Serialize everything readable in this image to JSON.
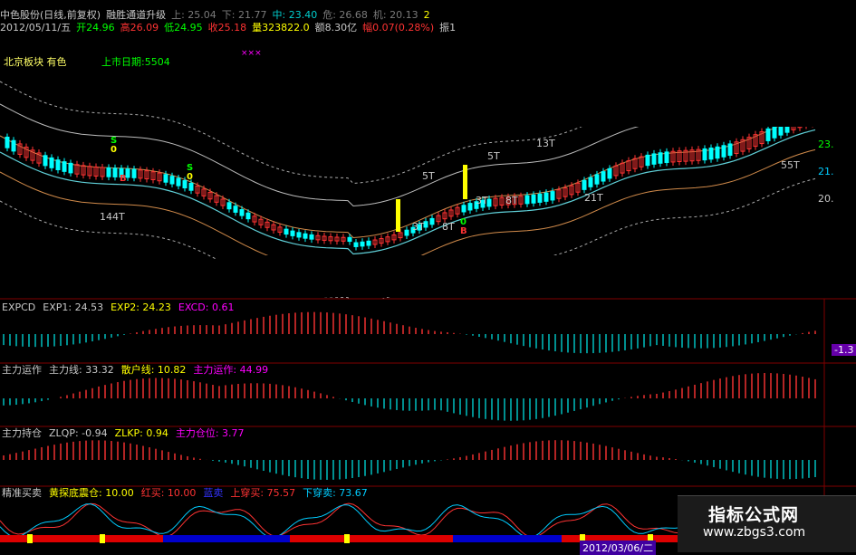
{
  "header": {
    "line1": [
      {
        "text": "中色股份(日线,前复权)",
        "color": "#c8c8c8"
      },
      {
        "text": "融胜通道升级",
        "color": "#c8c8c8"
      },
      {
        "text": "上: 25.04",
        "color": "#7a7a7a"
      },
      {
        "text": "下: 21.77",
        "color": "#7a7a7a"
      },
      {
        "text": "中: 23.40",
        "color": "#00d0d0"
      },
      {
        "text": "危: 26.68",
        "color": "#7a7a7a"
      },
      {
        "text": "机: 20.13",
        "color": "#7a7a7a"
      },
      {
        "text": "2",
        "color": "#ffff00"
      }
    ],
    "line2": [
      {
        "text": "2012/05/11/五",
        "color": "#c8c8c8"
      },
      {
        "text": "开24.96",
        "color": "#00ff00"
      },
      {
        "text": "高26.09",
        "color": "#ff3333"
      },
      {
        "text": "低24.95",
        "color": "#00ff00"
      },
      {
        "text": "收25.18",
        "color": "#ff3333"
      },
      {
        "text": "量323822.0",
        "color": "#ffff00"
      },
      {
        "text": "额8.30亿",
        "color": "#c8c8c8"
      },
      {
        "text": "幅0.07(0.28%)",
        "color": "#ff3333"
      },
      {
        "text": "振1",
        "color": "#c8c8c8"
      }
    ],
    "board_label": "北京板块 有色",
    "listing_label": "上市日期:5504",
    "xxx": "×××"
  },
  "main_labels": [
    {
      "text": "S",
      "color": "#00ff00"
    },
    {
      "text": "0",
      "color": "#ffff00"
    },
    {
      "text": "B",
      "color": "#ff3333"
    },
    {
      "text": "S",
      "color": "#00ff00"
    },
    {
      "text": "0",
      "color": "#ffff00"
    },
    {
      "text": "144T",
      "color": "#c8c8c8"
    },
    {
      "text": "3T",
      "color": "#c8c8c8"
    },
    {
      "text": "8T",
      "color": "#c8c8c8"
    },
    {
      "text": "5T",
      "color": "#c8c8c8"
    },
    {
      "text": "0",
      "color": "#00ff00"
    },
    {
      "text": "B",
      "color": "#ff3333"
    },
    {
      "text": "3T",
      "color": "#c8c8c8"
    },
    {
      "text": "8T",
      "color": "#c8c8c8"
    },
    {
      "text": "5T",
      "color": "#c8c8c8"
    },
    {
      "text": "13T",
      "color": "#c8c8c8"
    },
    {
      "text": "21T",
      "color": "#c8c8c8"
    },
    {
      "text": "55T",
      "color": "#c8c8c8"
    }
  ],
  "right_axis": [
    {
      "text": "23.",
      "color": "#00ff00"
    },
    {
      "text": "21.",
      "color": "#00ccff"
    },
    {
      "text": "20.",
      "color": "#c8c8c8"
    },
    {
      "text": "-1.3",
      "color": "#ffffff"
    }
  ],
  "panels": [
    {
      "name": "EXPCD",
      "items": [
        {
          "text": "EXPCD",
          "color": "#c8c8c8"
        },
        {
          "text": "EXP1: 24.53",
          "color": "#c8c8c8"
        },
        {
          "text": "EXP2: 24.23",
          "color": "#ffff00"
        },
        {
          "text": "EXCD: 0.61",
          "color": "#ff00ff"
        }
      ]
    },
    {
      "name": "主力运作",
      "items": [
        {
          "text": "主力运作",
          "color": "#c8c8c8"
        },
        {
          "text": "主力线: 33.32",
          "color": "#c8c8c8"
        },
        {
          "text": "散户线: 10.82",
          "color": "#ffff00"
        },
        {
          "text": "主力运作: 44.99",
          "color": "#ff00ff"
        }
      ]
    },
    {
      "name": "主力持仓",
      "items": [
        {
          "text": "主力持仓",
          "color": "#c8c8c8"
        },
        {
          "text": "ZLQP: -0.94",
          "color": "#c8c8c8"
        },
        {
          "text": "ZLKP: 0.94",
          "color": "#ffff00"
        },
        {
          "text": "主力仓位: 3.77",
          "color": "#ff00ff"
        }
      ]
    },
    {
      "name": "精准买卖",
      "items": [
        {
          "text": "精准买卖",
          "color": "#c8c8c8"
        },
        {
          "text": "黄探底震仓: 10.00",
          "color": "#ffff00"
        },
        {
          "text": "红买: 10.00",
          "color": "#ff3333"
        },
        {
          "text": "蓝卖",
          "color": "#3333ff"
        },
        {
          "text": "上穿买: 75.57",
          "color": "#ff3333"
        },
        {
          "text": "下穿卖: 73.67",
          "color": "#00ccff"
        }
      ]
    }
  ],
  "bottom_date": "2012/03/06/二",
  "watermark": {
    "title": "指标公式网",
    "url": "www.zbgs3.com"
  },
  "colors": {
    "up": "#ff3333",
    "down": "#00ffff",
    "grid": "#800000",
    "mid": "#5fd0d8",
    "band": "#d08a4a",
    "dotted": "#aaaaaa"
  }
}
